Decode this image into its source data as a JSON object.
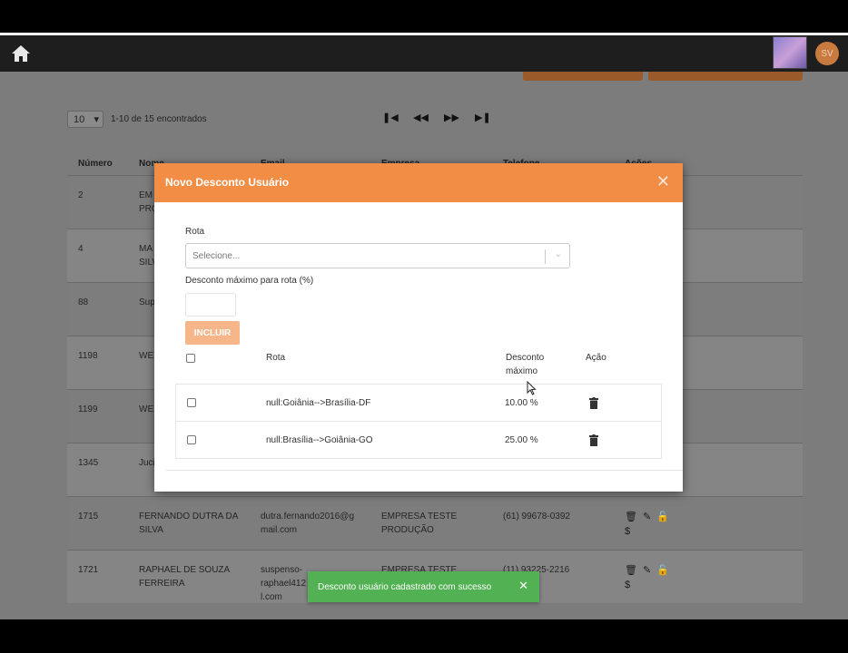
{
  "navbar": {
    "home_icon": "home-icon",
    "app_icon": "app-logo-icon",
    "avatar_initials": "SV"
  },
  "pagination": {
    "per_page": "10",
    "found_text": "1-10 de 15 encontrados",
    "icons": [
      "first-page-icon",
      "previous-page-icon",
      "next-page-icon",
      "last-page-icon"
    ]
  },
  "table": {
    "headers": [
      "Número",
      "Nome",
      "Email",
      "Empresa",
      "Telefone",
      "Ações"
    ],
    "rows": [
      {
        "numero": "2",
        "nome": "EM\nPRO",
        "email": "",
        "empresa": "",
        "telefone": ""
      },
      {
        "numero": "4",
        "nome": "MA\nSILV",
        "email": "",
        "empresa": "",
        "telefone": ""
      },
      {
        "numero": "88",
        "nome": "Sup",
        "email": "",
        "empresa": "",
        "telefone": ""
      },
      {
        "numero": "1198",
        "nome": "WE",
        "email": "",
        "empresa": "",
        "telefone": ""
      },
      {
        "numero": "1199",
        "nome": "WE",
        "email": "",
        "empresa": "",
        "telefone": ""
      },
      {
        "numero": "1345",
        "nome": "Juci",
        "email": "",
        "empresa": "",
        "telefone": ""
      },
      {
        "numero": "1715",
        "nome": "FERNANDO DUTRA DA\nSILVA",
        "email": "dutra.fernando2016@g\nmail.com",
        "empresa": "EMPRESA TESTE\nPRODUÇÃO",
        "telefone": "(61) 99678-0392"
      },
      {
        "numero": "1721",
        "nome": "RAPHAEL DE SOUZA\nFERREIRA",
        "email": "suspenso-\nraphael412\nl.com",
        "empresa": "EMPRESA TESTE",
        "telefone": "(11) 93225-2216"
      }
    ]
  },
  "modal": {
    "title": "Novo Desconto Usuário",
    "rota_label": "Rota",
    "rota_placeholder": "Selecione...",
    "desconto_label": "Desconto máximo para rota (%)",
    "incluir_label": "INCLUIR",
    "grid_headers": {
      "rota": "Rota",
      "desconto": "Desconto\nmáximo",
      "acao": "Ação"
    },
    "items": [
      {
        "rota": "null:Goiânia-->Brasília-DF",
        "desconto": "10.00 %"
      },
      {
        "rota": "null:Brasília-->Goiânia-GO",
        "desconto": "25.00 %"
      }
    ]
  },
  "toast": {
    "message": "Desconto usuário cadastrado com sucesso"
  },
  "colors": {
    "modal_header": "#f28d46",
    "toast": "#52b152",
    "incluir": "#f6b68a"
  }
}
